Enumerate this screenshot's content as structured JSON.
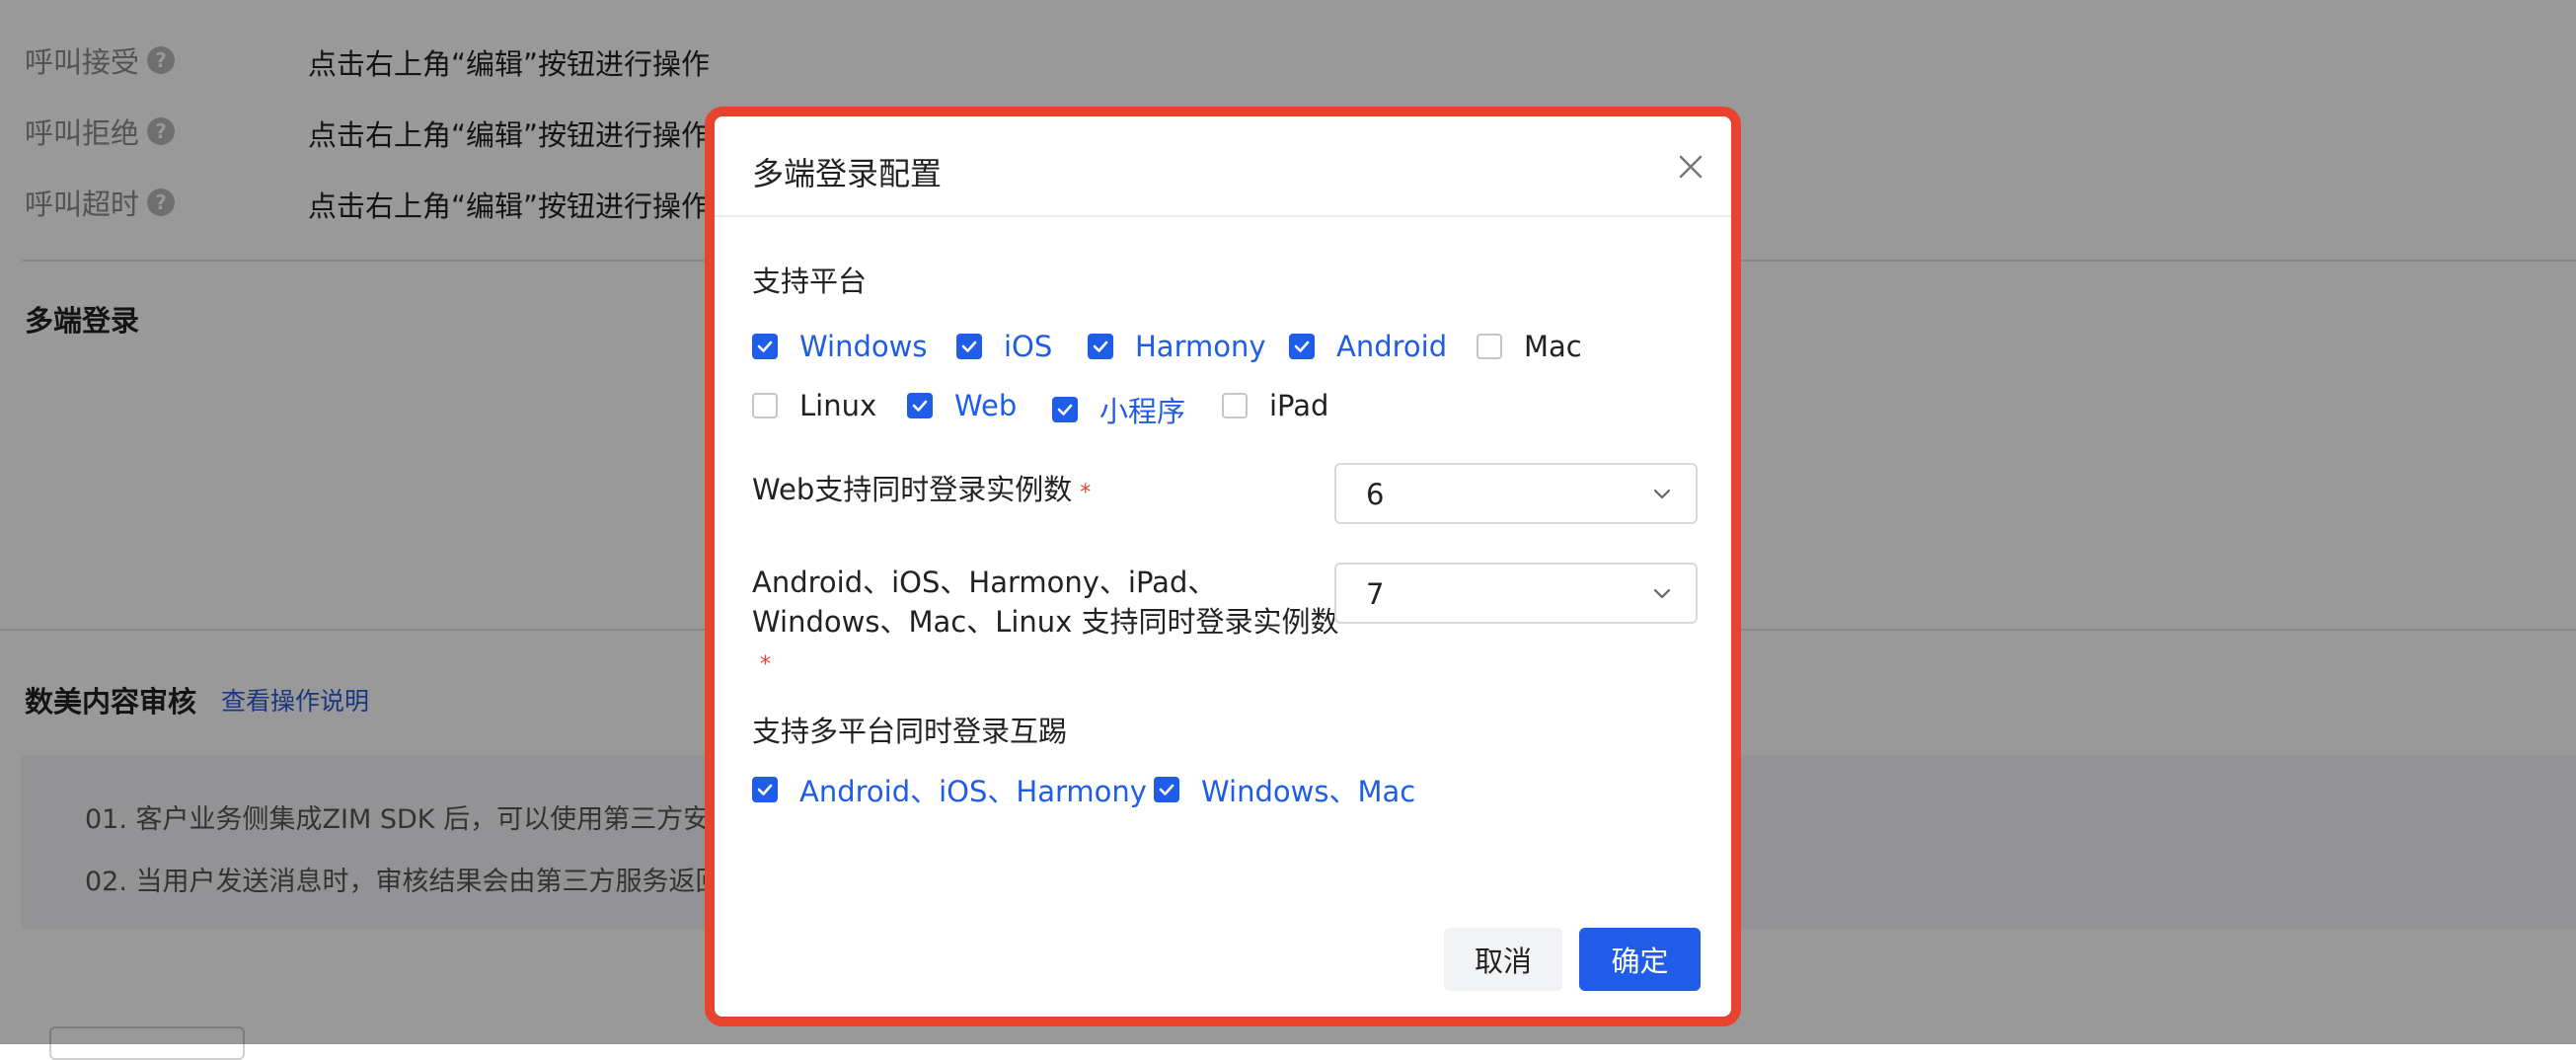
{
  "background": {
    "rows": [
      {
        "label": "呼叫接受",
        "value": "点击右上角“编辑”按钮进行操作"
      },
      {
        "label": "呼叫拒绝",
        "value": "点击右上角“编辑”按钮进行操作"
      },
      {
        "label": "呼叫超时",
        "value": "点击右上角“编辑”按钮进行操作"
      }
    ],
    "help_glyph": "?",
    "section_multi_login": "多端登录",
    "section_moderation": "数美内容审核",
    "moderation_link": "查看操作说明",
    "notice_lines": [
      "01. 客户业务侧集成ZIM SDK 后，可以使用第三方安",
      "02. 当用户发送消息时，审核结果会由第三方服务返回"
    ]
  },
  "modal": {
    "title": "多端登录配置",
    "supported_platforms_title": "支持平台",
    "platforms": [
      {
        "label": "Windows",
        "checked": true
      },
      {
        "label": "iOS",
        "checked": true
      },
      {
        "label": "Harmony",
        "checked": true
      },
      {
        "label": "Android",
        "checked": true
      },
      {
        "label": "Mac",
        "checked": false
      },
      {
        "label": "Linux",
        "checked": false
      },
      {
        "label": "Web",
        "checked": true
      },
      {
        "label": "小程序",
        "checked": true
      },
      {
        "label": "iPad",
        "checked": false
      }
    ],
    "web_instances_label": "Web支持同时登录实例数",
    "web_instances_value": "6",
    "native_instances_label_line1": "Android、iOS、Harmony、iPad、",
    "native_instances_label_line2": "Windows、Mac、Linux 支持同时登录实例数",
    "native_instances_value": "7",
    "required_mark": "*",
    "kick_title": "支持多平台同时登录互踢",
    "kick_options": [
      {
        "label": "Android、iOS、Harmony",
        "checked": true
      },
      {
        "label": "Windows、Mac",
        "checked": true
      }
    ],
    "cancel_label": "取消",
    "confirm_label": "确定"
  },
  "colors": {
    "accent": "#1f5de8",
    "highlight_border": "#e8432c",
    "required": "#e8432c"
  },
  "icons": [
    "help-icon",
    "close-icon",
    "checkbox-check-icon",
    "chevron-down-icon"
  ]
}
